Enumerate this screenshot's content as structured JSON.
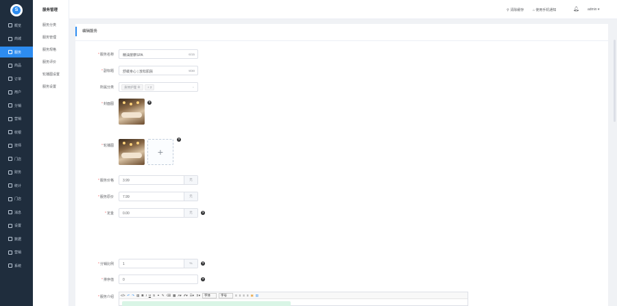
{
  "sidebar": {
    "logo_text": "S",
    "items": [
      {
        "label": "概览",
        "icon": "home-icon"
      },
      {
        "label": "商城",
        "icon": "shop-icon"
      },
      {
        "label": "服务",
        "icon": "service-icon",
        "active": true
      },
      {
        "label": "商品",
        "icon": "goods-icon"
      },
      {
        "label": "订单",
        "icon": "order-icon"
      },
      {
        "label": "用户",
        "icon": "user-icon"
      },
      {
        "label": "分销",
        "icon": "distribution-icon"
      },
      {
        "label": "营销",
        "icon": "marketing-icon"
      },
      {
        "label": "收银",
        "icon": "cashier-icon"
      },
      {
        "label": "技师",
        "icon": "technician-icon"
      },
      {
        "label": "门店",
        "icon": "store-icon"
      },
      {
        "label": "财务",
        "icon": "finance-icon"
      },
      {
        "label": "统计",
        "icon": "stats-icon"
      },
      {
        "label": "门店",
        "icon": "store2-icon"
      },
      {
        "label": "消息",
        "icon": "message-icon"
      },
      {
        "label": "设置",
        "icon": "settings-icon"
      },
      {
        "label": "数据",
        "icon": "data-icon"
      },
      {
        "label": "营销",
        "icon": "promotion-icon"
      },
      {
        "label": "系统",
        "icon": "system-icon"
      }
    ]
  },
  "submenu": {
    "title": "服务管理",
    "items": [
      "服务分类",
      "服务管理",
      "服务规格",
      "服务评价",
      "轮播图设置",
      "服务设置"
    ]
  },
  "header": {
    "link1": "清除缓存",
    "link2": "使用手机通知",
    "user": "admin ▾"
  },
  "form": {
    "title": "编辑服务",
    "name_label": "服务名称",
    "name_value": "精油按摩SPA",
    "name_count": "6/15",
    "subtitle_label": "副标题",
    "subtitle_value": "舒缓身心 | 放松肌肤",
    "subtitle_count": "9/30",
    "category_label": "所属分类",
    "category_tag": "身体护理",
    "category_more": "+ 2",
    "cover_label": "封面图",
    "carousel_label": "轮播图",
    "price_label": "服务价格",
    "price_value": "3.99",
    "price_unit": "元",
    "original_label": "服务原价",
    "original_value": "7.99",
    "original_unit": "元",
    "deposit_label": "定金",
    "deposit_value": "0.00",
    "deposit_unit": "元",
    "commission_label": "分销比例",
    "commission_value": "1",
    "commission_unit": "%",
    "sort_label": "排序值",
    "sort_value": "0",
    "intro_label": "服务介绍",
    "toolbar_font": "字体",
    "toolbar_size": "字号"
  },
  "colors": {
    "sidebar_bg": "#1f2d3d",
    "accent": "#2d8cf0"
  }
}
